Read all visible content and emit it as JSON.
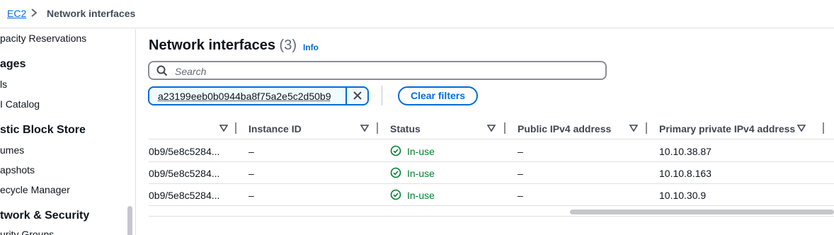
{
  "breadcrumb": {
    "root": "EC2",
    "current": "Network interfaces"
  },
  "sidebar": {
    "items": [
      {
        "label": "pacity Reservations",
        "kind": "link"
      },
      {
        "label": "ages",
        "kind": "heading"
      },
      {
        "label": "ls",
        "kind": "link"
      },
      {
        "label": "I Catalog",
        "kind": "link"
      },
      {
        "label": "stic Block Store",
        "kind": "heading"
      },
      {
        "label": "umes",
        "kind": "link"
      },
      {
        "label": "apshots",
        "kind": "link"
      },
      {
        "label": "ecycle Manager",
        "kind": "link"
      },
      {
        "label": "twork & Security",
        "kind": "heading"
      },
      {
        "label": "urity Groups",
        "kind": "link"
      }
    ]
  },
  "main": {
    "title": "Network interfaces",
    "count": "(3)",
    "info": "Info",
    "search_placeholder": "Search",
    "filter_token": "a23199eeb0b0944ba8f75a2e5c2d50b9",
    "clear_filters": "Clear filters"
  },
  "table": {
    "columns": [
      "",
      "Instance ID",
      "Status",
      "Public IPv4 address",
      "Primary private IPv4 address"
    ],
    "rows": [
      {
        "description": "0b9/5e8c5284...",
        "instance_id": "–",
        "status": "In-use",
        "public_ip": "–",
        "private_ip": "10.10.38.87"
      },
      {
        "description": "0b9/5e8c5284...",
        "instance_id": "–",
        "status": "In-use",
        "public_ip": "–",
        "private_ip": "10.10.8.163"
      },
      {
        "description": "0b9/5e8c5284...",
        "instance_id": "–",
        "status": "In-use",
        "public_ip": "–",
        "private_ip": "10.10.30.9"
      }
    ]
  },
  "colors": {
    "link": "#006ce0",
    "success": "#00802f",
    "border": "#dedfe3"
  },
  "icons": [
    "chevron-right-icon",
    "search-icon",
    "close-icon",
    "sort-caret-icon",
    "status-check-icon"
  ]
}
